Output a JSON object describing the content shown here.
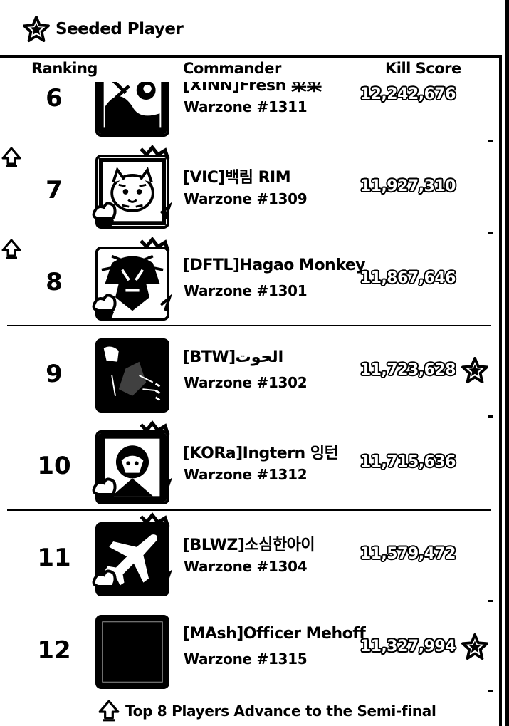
{
  "header": {
    "title": "Seeded Player"
  },
  "columns": {
    "ranking": "Ranking",
    "commander": "Commander",
    "kill_score": "Kill Score"
  },
  "rows": [
    {
      "rank": "6",
      "name": "[XINN]Fresh 菜菜",
      "warzone": "Warzone #1311",
      "score": "12,242,676",
      "seeded": false,
      "advance": false
    },
    {
      "rank": "7",
      "name": "[VIC]백림 RIM",
      "warzone": "Warzone #1309",
      "score": "11,927,310",
      "seeded": false,
      "advance": true
    },
    {
      "rank": "8",
      "name": "[DFTL]Hagao Monkey",
      "warzone": "Warzone #1301",
      "score": "11,867,646",
      "seeded": false,
      "advance": true
    },
    {
      "rank": "9",
      "name": "[BTW]الحوت",
      "warzone": "Warzone #1302",
      "score": "11,723,628",
      "seeded": true,
      "advance": false
    },
    {
      "rank": "10",
      "name": "[KORa]Ingtern 잉턴",
      "warzone": "Warzone #1312",
      "score": "11,715,636",
      "seeded": false,
      "advance": false
    },
    {
      "rank": "11",
      "name": "[BLWZ]소심한아이",
      "warzone": "Warzone #1304",
      "score": "11,579,472",
      "seeded": false,
      "advance": false
    },
    {
      "rank": "12",
      "name": "[MAsh]Officer Mehoff",
      "warzone": "Warzone #1315",
      "score": "11,327,994",
      "seeded": true,
      "advance": false
    }
  ],
  "footer": {
    "note": "Top 8 Players Advance to the Semi-final"
  },
  "icons": {
    "seed": "star-badge-icon",
    "advance": "up-arrow-icon"
  }
}
